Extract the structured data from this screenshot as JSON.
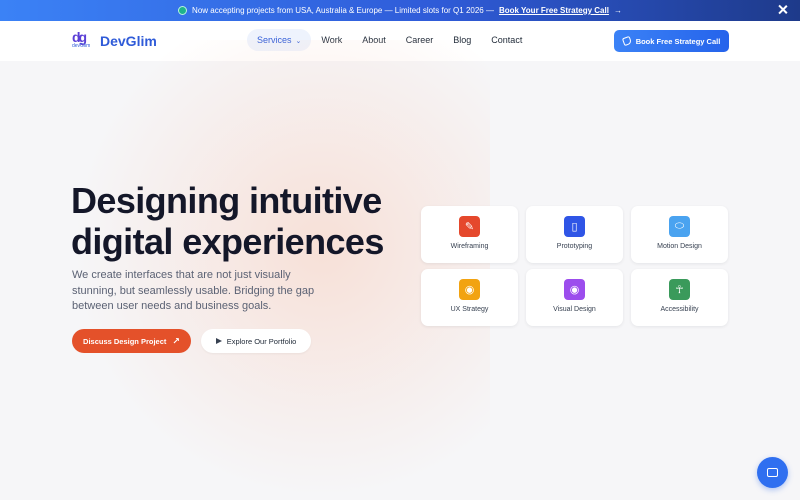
{
  "announcement": {
    "text": "Now accepting projects from USA, Australia & Europe — Limited slots for Q1 2026 —",
    "link": "Book Your Free Strategy Call",
    "arrow": "→"
  },
  "header": {
    "logo_mark": "dg",
    "logo_small": "devGlim",
    "logo_text": "DevGlim",
    "nav": [
      {
        "label": "Services",
        "chevron": "⌄"
      },
      {
        "label": "Work"
      },
      {
        "label": "About"
      },
      {
        "label": "Career"
      },
      {
        "label": "Blog"
      },
      {
        "label": "Contact"
      }
    ],
    "cta": "Book Free Strategy Call"
  },
  "hero": {
    "title": "Designing intuitive digital experiences",
    "subtitle": "We create interfaces that are not just visually stunning, but seamlessly usable. Bridging the gap between user needs and business goals.",
    "primary_button": "Discuss Design Project",
    "primary_arrow": "↗",
    "secondary_button": "Explore Our Portfolio"
  },
  "services": [
    {
      "label": "Wireframing",
      "icon": "brush-icon",
      "glyph": "✎",
      "color": "#e5482c"
    },
    {
      "label": "Prototyping",
      "icon": "mouse-icon",
      "glyph": "▯",
      "color": "#2f55e6"
    },
    {
      "label": "Motion Design",
      "icon": "pill-icon",
      "glyph": "⬭",
      "color": "#4aa3f0"
    },
    {
      "label": "UX Strategy",
      "icon": "lightbulb-icon",
      "glyph": "◉",
      "color": "#f2a311"
    },
    {
      "label": "Visual Design",
      "icon": "eye-icon",
      "glyph": "◉",
      "color": "#9c4ded"
    },
    {
      "label": "Accessibility",
      "icon": "person-icon",
      "glyph": "☥",
      "color": "#3a9a5b"
    }
  ]
}
